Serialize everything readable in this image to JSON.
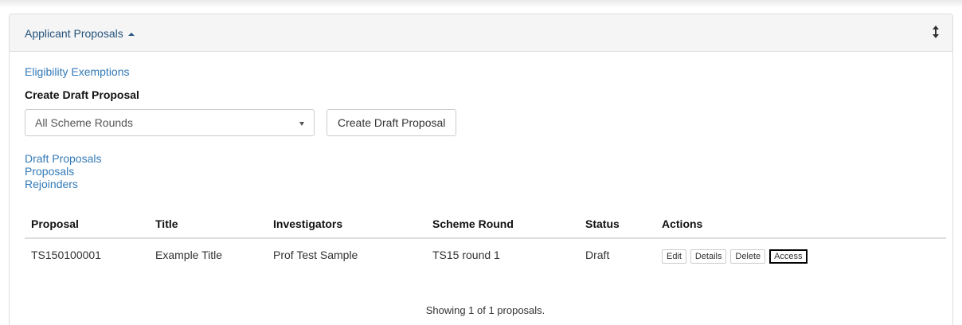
{
  "panel": {
    "title": "Applicant Proposals"
  },
  "links": {
    "eligibility_exemptions": "Eligibility Exemptions",
    "draft_proposals": "Draft Proposals",
    "proposals": "Proposals",
    "rejoinders": "Rejoinders"
  },
  "create": {
    "label": "Create Draft Proposal",
    "select_value": "All Scheme Rounds",
    "button_label": "Create Draft Proposal"
  },
  "table": {
    "headers": [
      "Proposal",
      "Title",
      "Investigators",
      "Scheme Round",
      "Status",
      "Actions"
    ],
    "rows": [
      {
        "proposal": "TS150100001",
        "title": "Example Title",
        "investigators": "Prof Test Sample",
        "scheme_round": "TS15 round 1",
        "status": "Draft",
        "actions": [
          "Edit",
          "Details",
          "Delete",
          "Access"
        ]
      }
    ]
  },
  "summary": "Showing 1 of 1 proposals.",
  "colors": {
    "link": "#337ab7",
    "title": "#23527c",
    "border": "#dddddd"
  },
  "icons": {
    "collapse": "caret-up-icon",
    "resize": "vertical-resize-icon"
  }
}
